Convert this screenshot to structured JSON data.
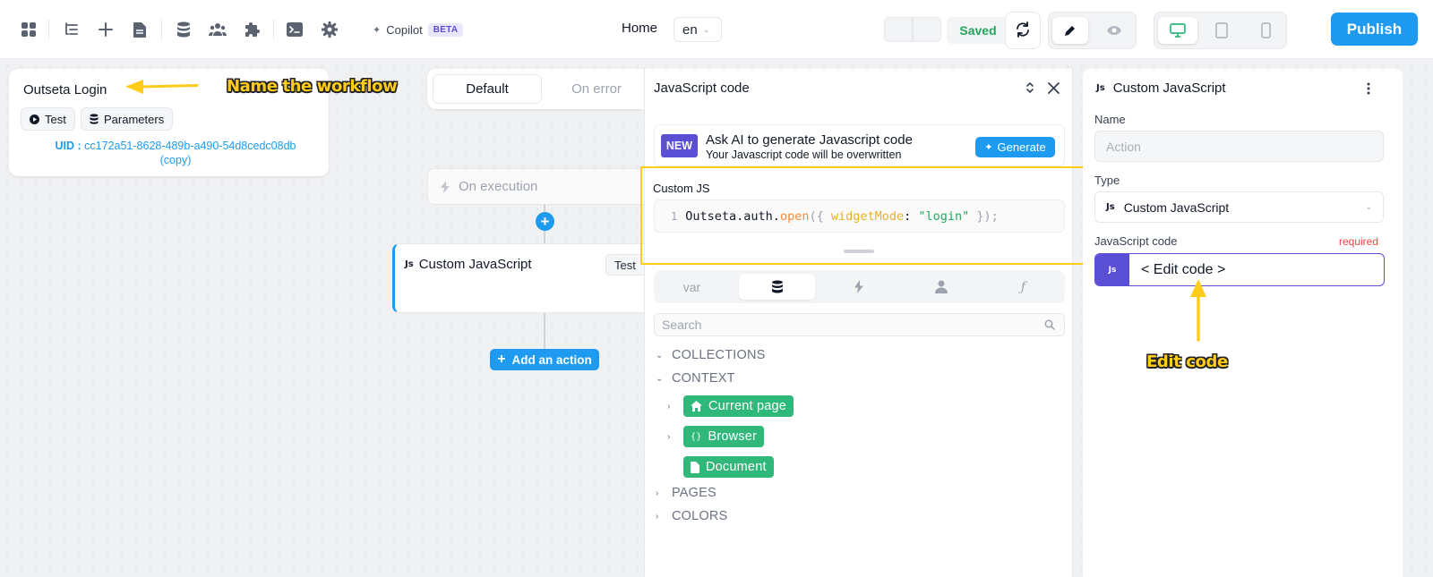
{
  "toolbar": {
    "icons": [
      "apps-icon",
      "layers-icon",
      "add-icon",
      "page-icon",
      "database-icon",
      "users-icon",
      "plugin-icon",
      "terminal-icon",
      "gear-icon"
    ],
    "copilot_label": "Copilot",
    "copilot_badge": "BETA",
    "page_name": "Home",
    "language": "en",
    "save_status": "Saved",
    "publish_label": "Publish"
  },
  "workflow": {
    "name": "Outseta Login",
    "test_label": "Test",
    "parameters_label": "Parameters",
    "uid_label": "UID :",
    "uid_value": "cc172a51-8628-489b-a490-54d8cedc08db",
    "copy_label": "(copy)"
  },
  "annotations": {
    "name_workflow": "Name the workflow",
    "edit_code": "Edit code",
    "color": "#ffcc1a"
  },
  "flow": {
    "tabs": [
      "Default",
      "On error"
    ],
    "active_tab": "Default",
    "trigger_label": "On execution",
    "action_icon": "Js",
    "action_title": "Custom JavaScript",
    "action_test_label": "Test",
    "add_action_label": "Add an action"
  },
  "js_panel": {
    "title": "JavaScript code",
    "new_badge": "NEW",
    "ai_title": "Ask AI to generate Javascript code",
    "ai_subtitle": "Your Javascript code will be overwritten",
    "generate_label": "Generate",
    "custom_js_label": "Custom JS",
    "line_number": "1",
    "code_tokens": {
      "obj": "Outseta",
      "dot1": ".",
      "prop": "auth",
      "dot2": ".",
      "method": "open",
      "paren_open": "({ ",
      "key": "widgetMode",
      "colon": ": ",
      "value": "\"login\"",
      "close": " });"
    },
    "var_tabs": [
      "var",
      "database-icon",
      "lightning-icon",
      "user-icon",
      "function-icon"
    ],
    "var_tab_var_label": "var",
    "var_tab_fn_label": "ƒ",
    "active_var_tab": 1,
    "search_placeholder": "Search",
    "tree": {
      "collections": "COLLECTIONS",
      "context": "CONTEXT",
      "current_page": "Current page",
      "browser": "Browser",
      "document": "Document",
      "pages": "PAGES",
      "colors": "COLORS"
    }
  },
  "right_panel": {
    "icon": "Js",
    "title": "Custom JavaScript",
    "name_label": "Name",
    "name_placeholder": "Action",
    "type_label": "Type",
    "type_icon": "Js",
    "type_value": "Custom JavaScript",
    "js_code_label": "JavaScript code",
    "required_label": "required",
    "js_tag": "Js",
    "edit_code_label": "< Edit code >"
  },
  "colors": {
    "primary": "#1e9bf0",
    "purple": "#5b4fd6",
    "green": "#2fb87a",
    "saved_green": "#22a85b",
    "required_red": "#ef4444"
  }
}
